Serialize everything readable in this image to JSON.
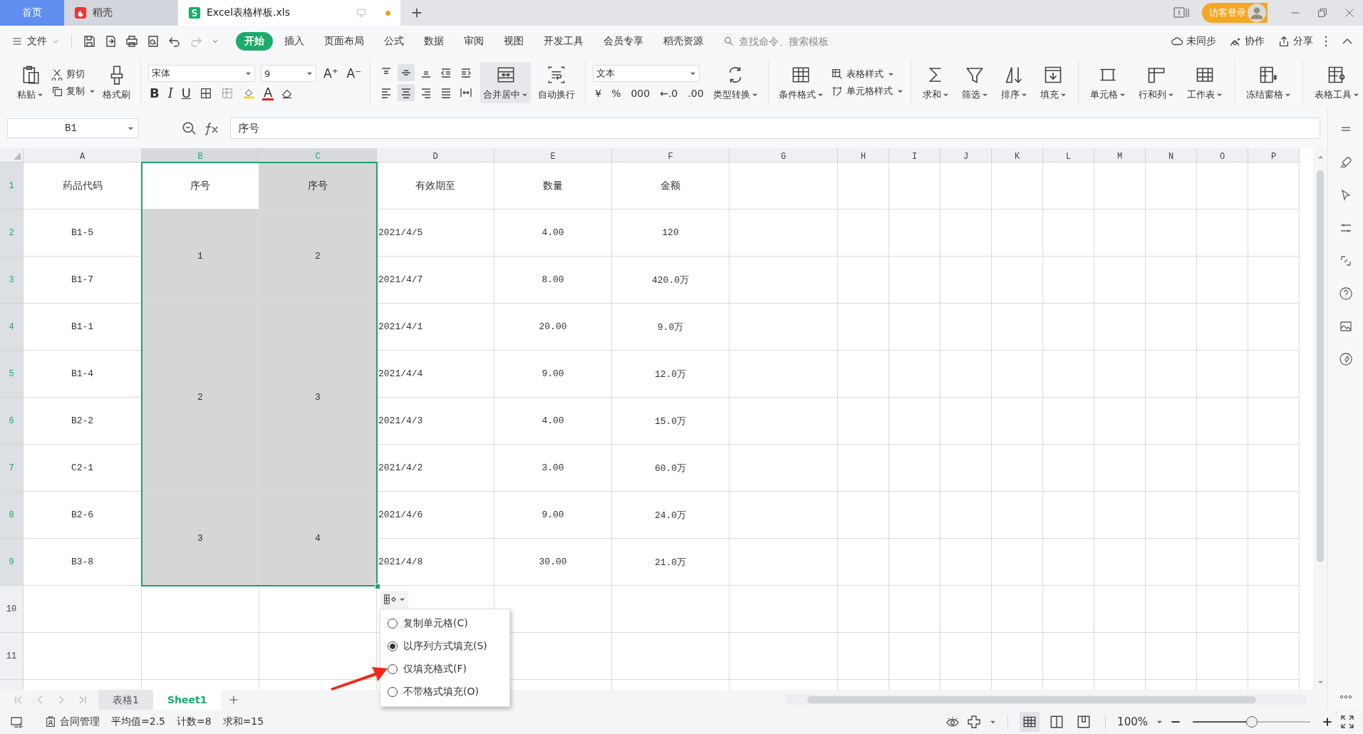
{
  "window_tabs": [
    {
      "kind": "home",
      "label": "首页",
      "selected": false
    },
    {
      "kind": "app",
      "label": "稻壳",
      "selected": false
    },
    {
      "kind": "document",
      "label": "Excel表格样板.xls",
      "selected": true,
      "unsaved": true
    }
  ],
  "account": {
    "login": "访客登录"
  },
  "menu": {
    "file": "文件",
    "tabs": [
      {
        "label": "开始",
        "selected": true
      },
      {
        "label": "插入",
        "selected": false
      },
      {
        "label": "页面布局",
        "selected": false
      },
      {
        "label": "公式",
        "selected": false
      },
      {
        "label": "数据",
        "selected": false
      },
      {
        "label": "审阅",
        "selected": false
      },
      {
        "label": "视图",
        "selected": false
      },
      {
        "label": "开发工具",
        "selected": false
      },
      {
        "label": "会员专享",
        "selected": false
      },
      {
        "label": "稻壳资源",
        "selected": false
      }
    ],
    "search": {
      "placeholder": "查找命令、搜索模板"
    },
    "actions": [
      "未同步",
      "协作",
      "分享"
    ]
  },
  "ribbon": {
    "paste": "粘贴",
    "cut": "剪切",
    "copy": "复制",
    "format_painter": "格式刷",
    "font": {
      "name": "宋体",
      "size": "9",
      "grow": "A⁺",
      "shrink": "A⁻",
      "bold": "B",
      "italic": "I",
      "underline": "U",
      "font_color_button": "A"
    },
    "align_buttons": [
      {
        "selected": false
      },
      {
        "selected": true
      },
      {
        "selected": false
      },
      {
        "selected": false
      },
      {
        "selected": false
      },
      {
        "selected": false
      },
      {
        "selected": true
      },
      {
        "selected": false
      },
      {
        "selected": false
      },
      {
        "selected": false
      }
    ],
    "merge": {
      "label": "合并居中",
      "selected": true
    },
    "wrap": "自动换行",
    "number": {
      "format": "文本",
      "symbols": [
        "¥",
        "%",
        "000",
        "←.0",
        ".00"
      ],
      "convert": "类型转换"
    },
    "conditional": "条件格式",
    "table_style": "表格样式",
    "cell_style": "单元格样式",
    "tools": [
      "求和",
      "筛选",
      "排序",
      "填充",
      "单元格",
      "行和列",
      "工作表",
      "冻结窗格",
      "表格工具"
    ]
  },
  "formula_bar": {
    "name_box": "B1",
    "formula": "序号"
  },
  "sheet": {
    "columns": [
      {
        "letter": "A",
        "selected": false
      },
      {
        "letter": "B",
        "selected": true
      },
      {
        "letter": "C",
        "selected": true
      },
      {
        "letter": "D",
        "selected": false
      },
      {
        "letter": "E",
        "selected": false
      },
      {
        "letter": "F",
        "selected": false
      },
      {
        "letter": "G",
        "selected": false
      },
      {
        "letter": "H",
        "selected": false
      },
      {
        "letter": "I",
        "selected": false
      },
      {
        "letter": "J",
        "selected": false
      },
      {
        "letter": "K",
        "selected": false
      },
      {
        "letter": "L",
        "selected": false
      },
      {
        "letter": "M",
        "selected": false
      },
      {
        "letter": "N",
        "selected": false
      },
      {
        "letter": "O",
        "selected": false
      },
      {
        "letter": "P",
        "selected": false
      }
    ],
    "header_row": {
      "number": "1",
      "selected": true,
      "cells": [
        "药品代码",
        "序号",
        "序号",
        "有效期至",
        "数量",
        "金额"
      ]
    },
    "groups": [
      {
        "merged": [
          "1",
          "2"
        ],
        "rows": [
          {
            "number": "2",
            "selected": true,
            "cells": [
              "B1-5",
              "2021/4/5",
              "4.00",
              "120"
            ]
          },
          {
            "number": "3",
            "selected": true,
            "cells": [
              "B1-7",
              "2021/4/7",
              "8.00",
              "420.0万"
            ]
          }
        ]
      },
      {
        "merged": [
          "2",
          "3"
        ],
        "rows": [
          {
            "number": "4",
            "selected": true,
            "cells": [
              "B1-1",
              "2021/4/1",
              "20.00",
              "9.0万"
            ]
          },
          {
            "number": "5",
            "selected": true,
            "cells": [
              "B1-4",
              "2021/4/4",
              "9.00",
              "12.0万"
            ]
          },
          {
            "number": "6",
            "selected": true,
            "cells": [
              "B2-2",
              "2021/4/3",
              "4.00",
              "15.0万"
            ]
          },
          {
            "number": "7",
            "selected": true,
            "cells": [
              "C2-1",
              "2021/4/2",
              "3.00",
              "60.0万"
            ]
          }
        ]
      },
      {
        "merged": [
          "3",
          "4"
        ],
        "rows": [
          {
            "number": "8",
            "selected": true,
            "cells": [
              "B2-6",
              "2021/4/6",
              "9.00",
              "24.0万"
            ]
          },
          {
            "number": "9",
            "selected": true,
            "cells": [
              "B3-8",
              "2021/4/8",
              "30.00",
              "21.0万"
            ]
          }
        ]
      }
    ],
    "empty_rows": [
      {
        "number": "10",
        "selected": false
      },
      {
        "number": "11",
        "selected": false
      }
    ]
  },
  "fill_options": [
    {
      "label": "复制单元格(C)",
      "selected": false
    },
    {
      "label": "以序列方式填充(S)",
      "selected": true
    },
    {
      "label": "仅填充格式(F)",
      "selected": false
    },
    {
      "label": "不带格式填充(O)",
      "selected": false
    }
  ],
  "sheet_tabs": [
    {
      "label": "表格1",
      "selected": false
    },
    {
      "label": "Sheet1",
      "selected": true
    }
  ],
  "status_bar": {
    "contract": "合同管理",
    "stats": [
      "平均值=2.5",
      "计数=8",
      "求和=15"
    ],
    "zoom": "100%",
    "zoom_slider": {
      "level": 0.5
    },
    "views": [
      {
        "selected": true
      },
      {
        "selected": false
      },
      {
        "selected": false
      }
    ]
  }
}
